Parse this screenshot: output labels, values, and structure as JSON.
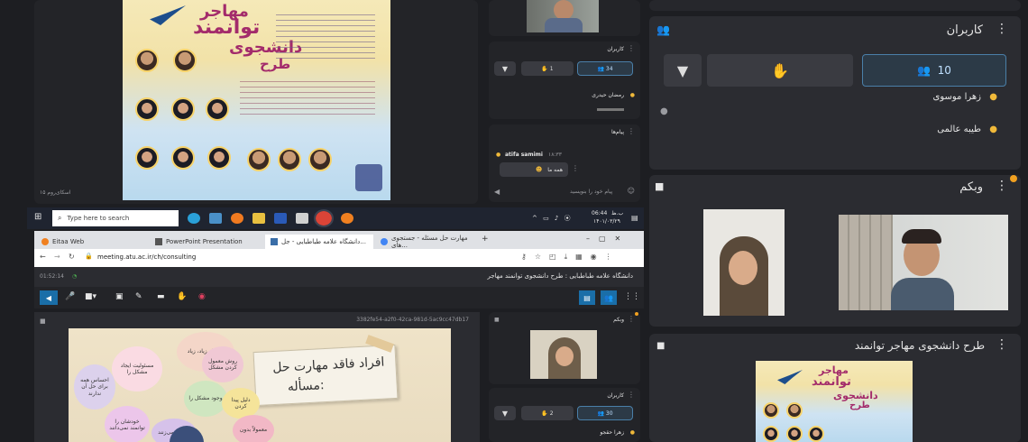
{
  "top_poster": {
    "title_line1": "مهاجر",
    "title_line2": "توانمند",
    "title_line3": "دانشجوی",
    "title_line4": "طرح",
    "footer_left": "اسکای‌روم ۱۵"
  },
  "mini_users": {
    "title": "کاربران",
    "count": "34",
    "hand_count": "1",
    "user1": "رمضان حیدری"
  },
  "mini_messages": {
    "title": "پیام‌ها",
    "sender": "atifa samimi",
    "time": "۱۸:۳۳",
    "message": "همه ما",
    "input_placeholder": "پیام خود را بنویسید"
  },
  "right_users": {
    "title": "کاربران",
    "count": "10",
    "user1": "زهرا موسوی",
    "user2": "طیبه عالمی"
  },
  "webcam": {
    "title": "وبکم"
  },
  "right_presentation": {
    "title": "طرح دانشجوی مهاجر توانمند",
    "poster_l1": "مهاجر",
    "poster_l2": "توانمند",
    "poster_l3": "دانشجوی",
    "poster_l4": "طرح"
  },
  "taskbar": {
    "search_placeholder": "Type here to search",
    "time": "06:44",
    "date": "۱۴۰۱/۰۳/۲۹",
    "lang": "ب.ظ"
  },
  "browser": {
    "tabs": [
      "Eitaa Web",
      "PowerPoint Presentation",
      "دانشگاه علامه طباطبایی - جل...",
      "مهارت حل مسئله - جستجوی های..."
    ],
    "url": "meeting.atu.ac.ir/ch/consulting"
  },
  "meeting": {
    "timer": "01:52:14",
    "room_title": "دانشگاه علامه طباطبایی : طرح دانشجوی توانمند مهاجر",
    "doc_id": "3382fe54-a2f0-42ca-981d-5ac9cc47db17",
    "slide_title_line1": "افراد فاقد مهارت حل",
    "slide_title_line2": "مسأله:",
    "bubbles": [
      "مشغله زیاد، زیاد",
      "مسئولیت ایجاد مشکل را",
      "احساس همه برای حل آن ندارند",
      "روش معمول کردن مشکل",
      "وجود مشکل را",
      "دلیل پیدا کردن",
      "خودشان را توانمند نمی‌دانند",
      "معمولاً بدون",
      "آیدیتان می‌زنند"
    ],
    "webcam_title": "وبکم",
    "users_title": "کاربران",
    "users_count": "30",
    "hand_count": "2",
    "user1": "زهرا حقجو"
  }
}
